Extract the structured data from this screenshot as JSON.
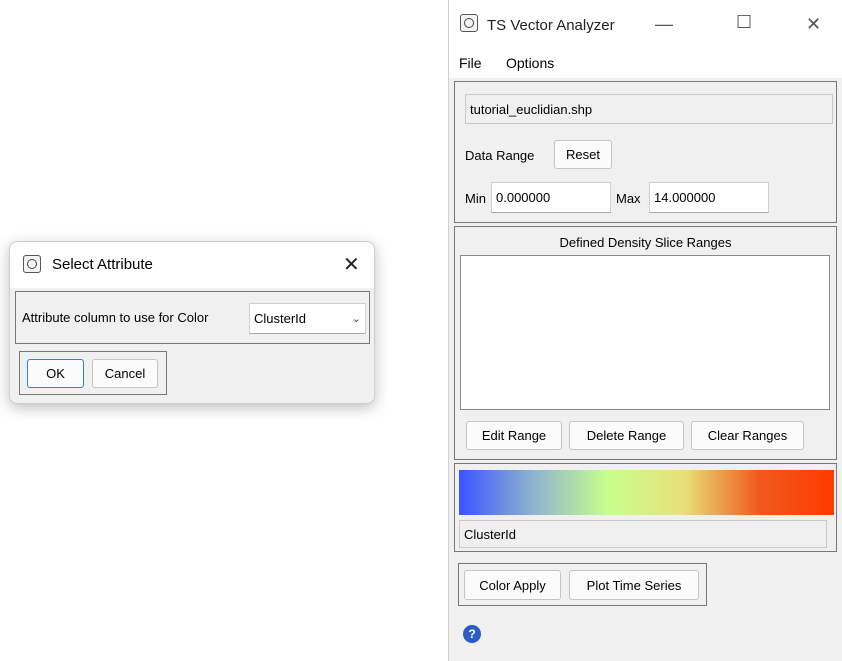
{
  "main_window": {
    "title": "TS Vector Analyzer",
    "menu": [
      "File",
      "Options"
    ],
    "filename": "tutorial_euclidian.shp",
    "data_range_label": "Data Range",
    "reset_label": "Reset",
    "min_label": "Min",
    "min_value": "0.000000",
    "max_label": "Max",
    "max_value": "14.000000",
    "slice_title": "Defined Density Slice Ranges",
    "edit_range_label": "Edit Range",
    "delete_range_label": "Delete Range",
    "clear_ranges_label": "Clear Ranges",
    "color_attribute": "ClusterId",
    "color_apply_label": "Color Apply",
    "plot_time_series_label": "Plot Time Series",
    "help_glyph": "?",
    "colors": {
      "ramp": [
        "#3a55ff",
        "#8fb4cf",
        "#c8ff8c",
        "#e8e07a",
        "#f05a1e",
        "#ff3a00"
      ]
    }
  },
  "select_dialog": {
    "title": "Select Attribute",
    "prompt": "Attribute column to use for Color",
    "selected": "ClusterId",
    "ok_label": "OK",
    "cancel_label": "Cancel"
  }
}
